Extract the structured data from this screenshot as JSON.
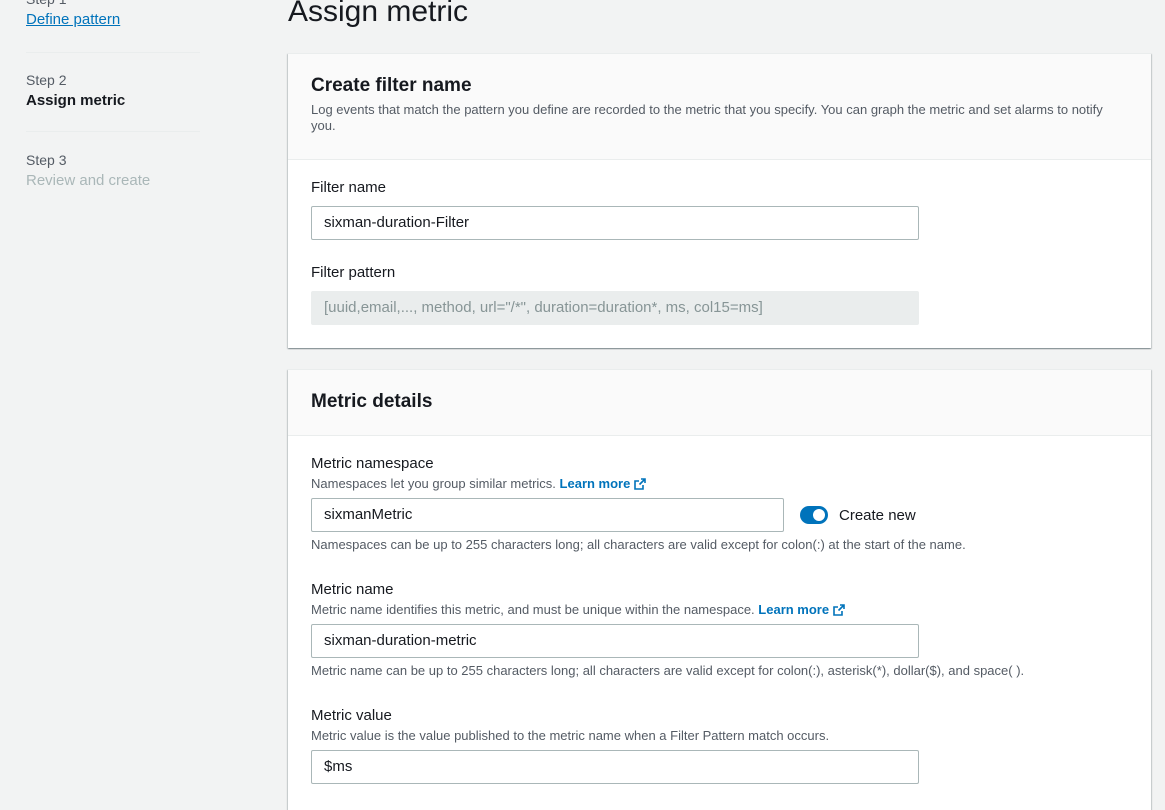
{
  "sidebar": {
    "steps": [
      {
        "label": "Step 1",
        "title": "Define pattern"
      },
      {
        "label": "Step 2",
        "title": "Assign metric"
      },
      {
        "label": "Step 3",
        "title": "Review and create"
      }
    ]
  },
  "page": {
    "title": "Assign metric"
  },
  "filter_panel": {
    "title": "Create filter name",
    "description": "Log events that match the pattern you define are recorded to the metric that you specify. You can graph the metric and set alarms to notify you.",
    "filter_name": {
      "label": "Filter name",
      "value": "sixman-duration-Filter"
    },
    "filter_pattern": {
      "label": "Filter pattern",
      "value": "[uuid,email,..., method, url=\"/*\", duration=duration*, ms, col15=ms]"
    }
  },
  "metric_panel": {
    "title": "Metric details",
    "namespace": {
      "label": "Metric namespace",
      "description": "Namespaces let you group similar metrics.",
      "learn_more": "Learn more",
      "value": "sixmanMetric",
      "toggle_label": "Create new",
      "toggle_on": true,
      "hint": "Namespaces can be up to 255 characters long; all characters are valid except for colon(:) at the start of the name."
    },
    "metric_name": {
      "label": "Metric name",
      "description": "Metric name identifies this metric, and must be unique within the namespace.",
      "learn_more": "Learn more",
      "value": "sixman-duration-metric",
      "hint": "Metric name can be up to 255 characters long; all characters are valid except for colon(:), asterisk(*), dollar($), and space( )."
    },
    "metric_value": {
      "label": "Metric value",
      "description": "Metric value is the value published to the metric name when a Filter Pattern match occurs.",
      "value": "$ms"
    }
  },
  "colors": {
    "link": "#0073bb",
    "toggle": "#0073bb",
    "background": "#f2f3f3"
  },
  "icons": {
    "external_link": "external-link-icon"
  }
}
